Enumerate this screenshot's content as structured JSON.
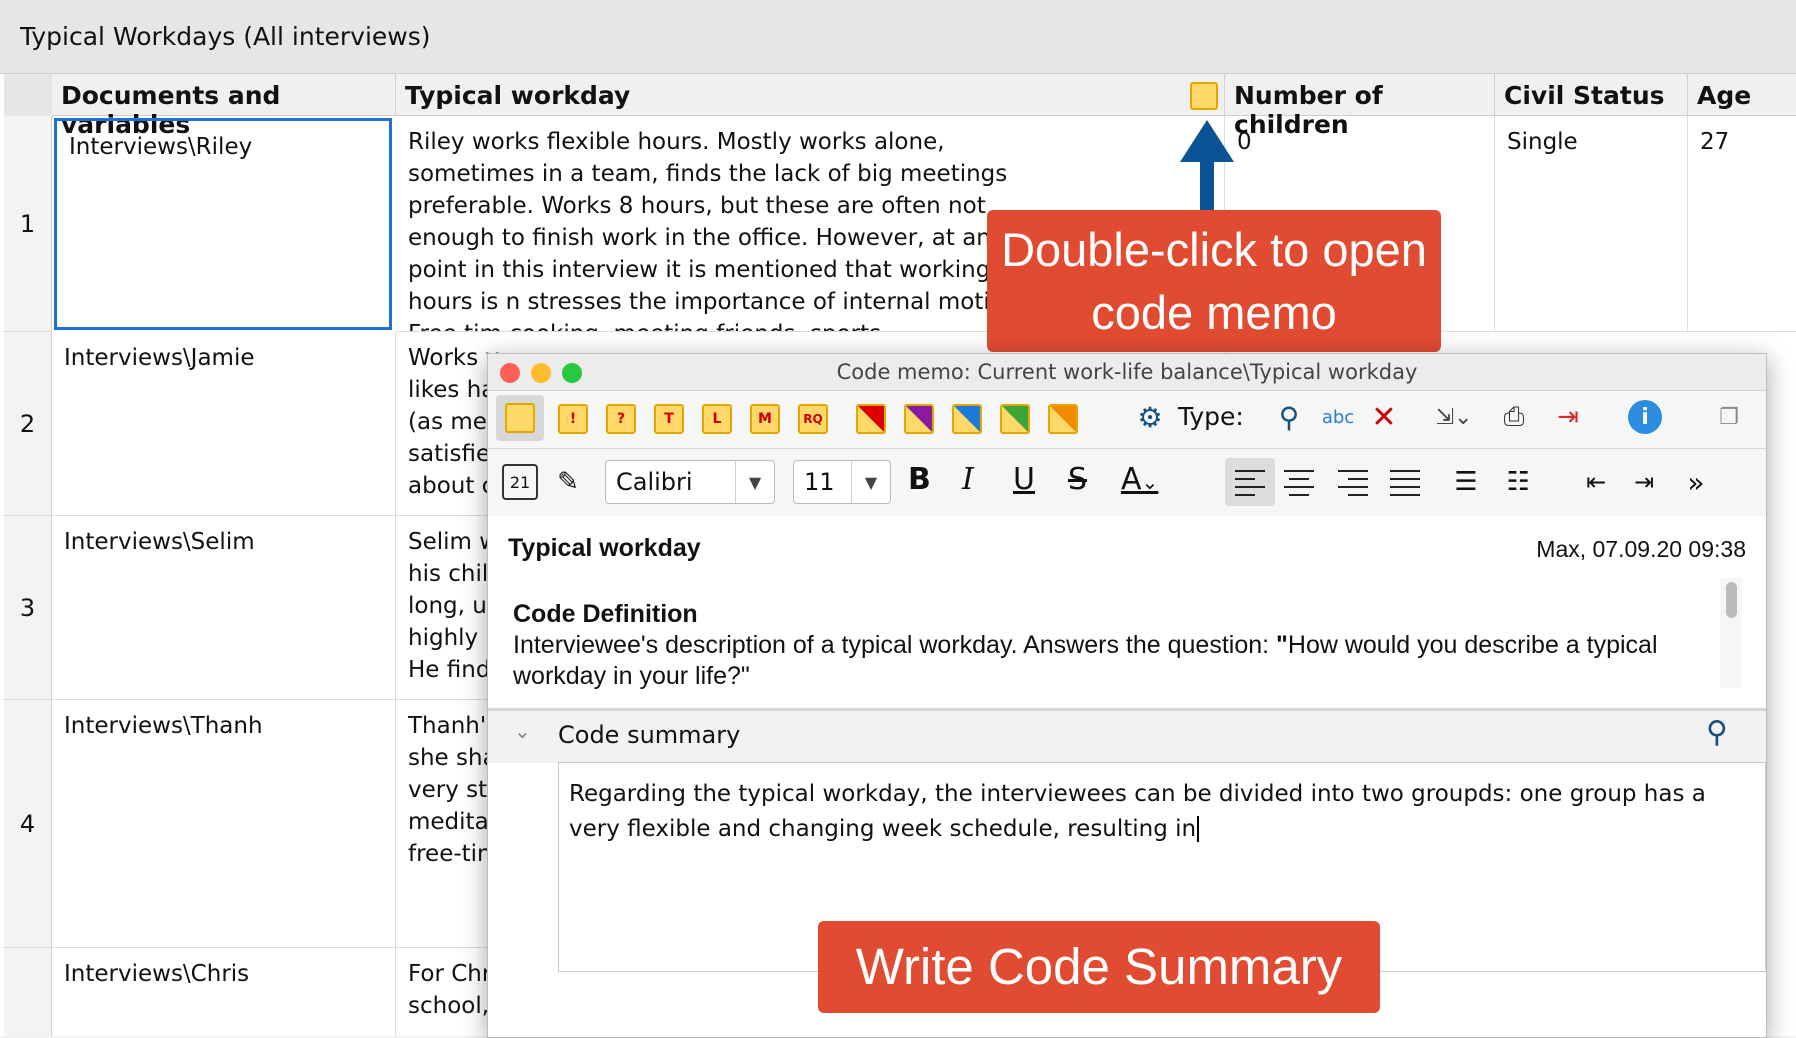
{
  "window_title": "Typical Workdays (All interviews)",
  "columns": [
    "Documents and variables",
    "Typical workday",
    "Number of children",
    "Civil Status",
    "Age"
  ],
  "rows": [
    {
      "num": "1",
      "doc": "Interviews\\Riley",
      "workday": "Riley works flexible hours. Mostly works alone, sometimes in a team, finds the lack of big meetings preferable. Works 8 hours, but these are often not enough to finish work in the office. However, at another point in this interview it is mentioned that working out of hours is n stresses the importance of internal motivation. Free tim cooking, meeting friends, sports.",
      "children": "0",
      "civil": "Single",
      "age": "27"
    },
    {
      "num": "2",
      "doc": "Interviews\\Jamie",
      "workday": "Works v likes ha (as mer satisfie about c",
      "children": "",
      "civil": "",
      "age": ""
    },
    {
      "num": "3",
      "doc": "Interviews\\Selim",
      "workday": "Selim w his chil long, ur highly u He find",
      "children": "",
      "civil": "",
      "age": ""
    },
    {
      "num": "4",
      "doc": "Interviews\\Thanh",
      "workday": "Thanh's she sha very str meditat free-tim",
      "children": "",
      "civil": "",
      "age": ""
    },
    {
      "num": "",
      "doc": "Interviews\\Chris",
      "workday": "For Chr school,",
      "children": "",
      "civil": "",
      "age": ""
    }
  ],
  "callouts": {
    "top": "Double-click to open code memo",
    "bottom": "Write Code Summary"
  },
  "memo": {
    "title": "Code memo: Current work-life balance\\Typical workday",
    "type_label": "Type:",
    "font": "Calibri",
    "size": "11",
    "memo_types": [
      "!",
      "?",
      "T",
      "L",
      "M",
      "RQ"
    ],
    "heading": "Typical workday",
    "author_date": "Max, 07.09.20 09:38",
    "def_title": "Code Definition",
    "def_text_1": "Interviewee's description of a typical workday. Answers the question: ",
    "def_quote": "\"",
    "def_text_2": "How would you describe a typical workday in your life?\"",
    "summary_label": "Code summary",
    "summary_text": "Regarding the typical workday, the interviewees can be divided into two groupds: one group has a very flexible and changing week schedule, resulting in"
  },
  "colors": {
    "callout": "#e14b32",
    "arrow": "#0b5394",
    "selection": "#1e6fd8"
  }
}
